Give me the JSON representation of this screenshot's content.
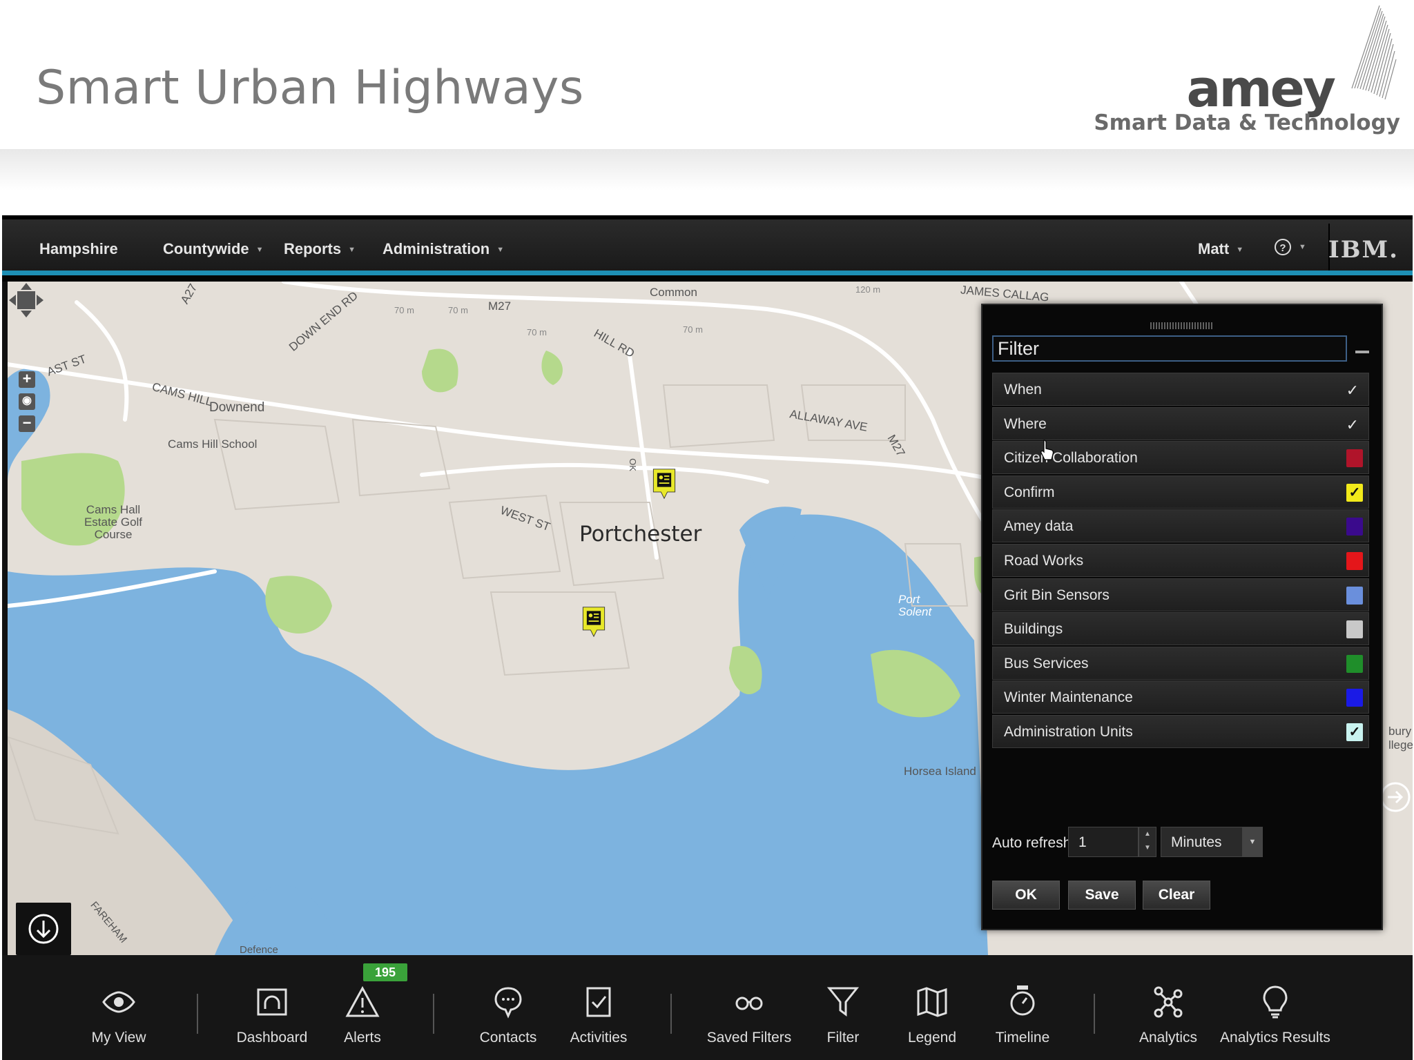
{
  "slide": {
    "title": "Smart Urban Highways",
    "brand": "amey",
    "tagline": "Smart Data & Technology"
  },
  "topbar": {
    "items": [
      {
        "label": "Hampshire"
      },
      {
        "label": "Countywide"
      },
      {
        "label": "Reports"
      },
      {
        "label": "Administration"
      }
    ],
    "user": "Matt",
    "help_icon": "question-circle-icon",
    "vendor_logo": "IBM."
  },
  "map": {
    "place_labels": {
      "portchester": "Portchester",
      "downend": "Downend",
      "cams_hill_school": "Cams Hill School",
      "cams_hall": "Cams Hall Estate Golf Course",
      "horsea": "Horsea Island",
      "port_solent": "Port Solent",
      "m27": "M27",
      "m27b": "M27",
      "hill_rd": "HILL RD",
      "allaway": "ALLAWAY AVE",
      "west_st": "WEST ST",
      "cams_hill": "CAMS HILL",
      "down_end_rd": "DOWN END RD",
      "james_callaghan": "JAMES CALLAG",
      "common": "Common",
      "a27": "A27",
      "ast_st": "AST ST",
      "contour_70a": "70 m",
      "contour_70b": "70 m",
      "contour_70c": "70 m",
      "contour_70d": "70 m",
      "contour_120": "120 m",
      "fareham": "FAREHAM",
      "defence": "Defence",
      "bury": "bury",
      "llege": "llege",
      "ok": "OK"
    },
    "markers": [
      "citizen-report-marker",
      "citizen-report-marker"
    ]
  },
  "filter": {
    "title": "Filter",
    "items": [
      {
        "label": "When",
        "mark": "✓",
        "type": "check"
      },
      {
        "label": "Where",
        "mark": "✓",
        "type": "check"
      },
      {
        "label": "Citizen Collaboration",
        "color": "#b0142a",
        "type": "swatch"
      },
      {
        "label": "Confirm",
        "color": "#f2ea1a",
        "mark": "✓",
        "type": "swatch"
      },
      {
        "label": "Amey data",
        "color": "#3a0a8c",
        "type": "swatch"
      },
      {
        "label": "Road Works",
        "color": "#e4161a",
        "type": "swatch"
      },
      {
        "label": "Grit Bin Sensors",
        "color": "#6a8fdc",
        "type": "swatch"
      },
      {
        "label": "Buildings",
        "color": "#c8c8c8",
        "type": "swatch"
      },
      {
        "label": "Bus Services",
        "color": "#1f8e2a",
        "type": "swatch"
      },
      {
        "label": "Winter Maintenance",
        "color": "#1a1ae6",
        "type": "swatch"
      },
      {
        "label": "Administration Units",
        "color": "#c9f3f0",
        "mark": "✓",
        "type": "swatch"
      }
    ],
    "auto_refresh_label": "Auto refresh:",
    "auto_refresh_value": "1",
    "auto_refresh_unit": "Minutes",
    "buttons": {
      "ok": "OK",
      "save": "Save",
      "clear": "Clear"
    }
  },
  "toolbar": {
    "items": [
      {
        "label": "My View",
        "icon": "eye-icon"
      },
      {
        "label": "Dashboard",
        "icon": "dashboard-icon"
      },
      {
        "label": "Alerts",
        "icon": "alert-triangle-icon"
      },
      {
        "label": "Contacts",
        "icon": "chat-bubble-icon"
      },
      {
        "label": "Activities",
        "icon": "checklist-icon"
      },
      {
        "label": "Saved Filters",
        "icon": "glasses-icon"
      },
      {
        "label": "Filter",
        "icon": "funnel-icon"
      },
      {
        "label": "Legend",
        "icon": "map-icon"
      },
      {
        "label": "Timeline",
        "icon": "stopwatch-icon"
      },
      {
        "label": "Analytics",
        "icon": "network-icon"
      },
      {
        "label": "Analytics Results",
        "icon": "lightbulb-icon"
      }
    ],
    "alerts_count": "195"
  },
  "colors": {
    "accent": "#1e8fb5",
    "water": "#7db3df",
    "park": "#b5d98c",
    "land": "#e4dfd8"
  }
}
